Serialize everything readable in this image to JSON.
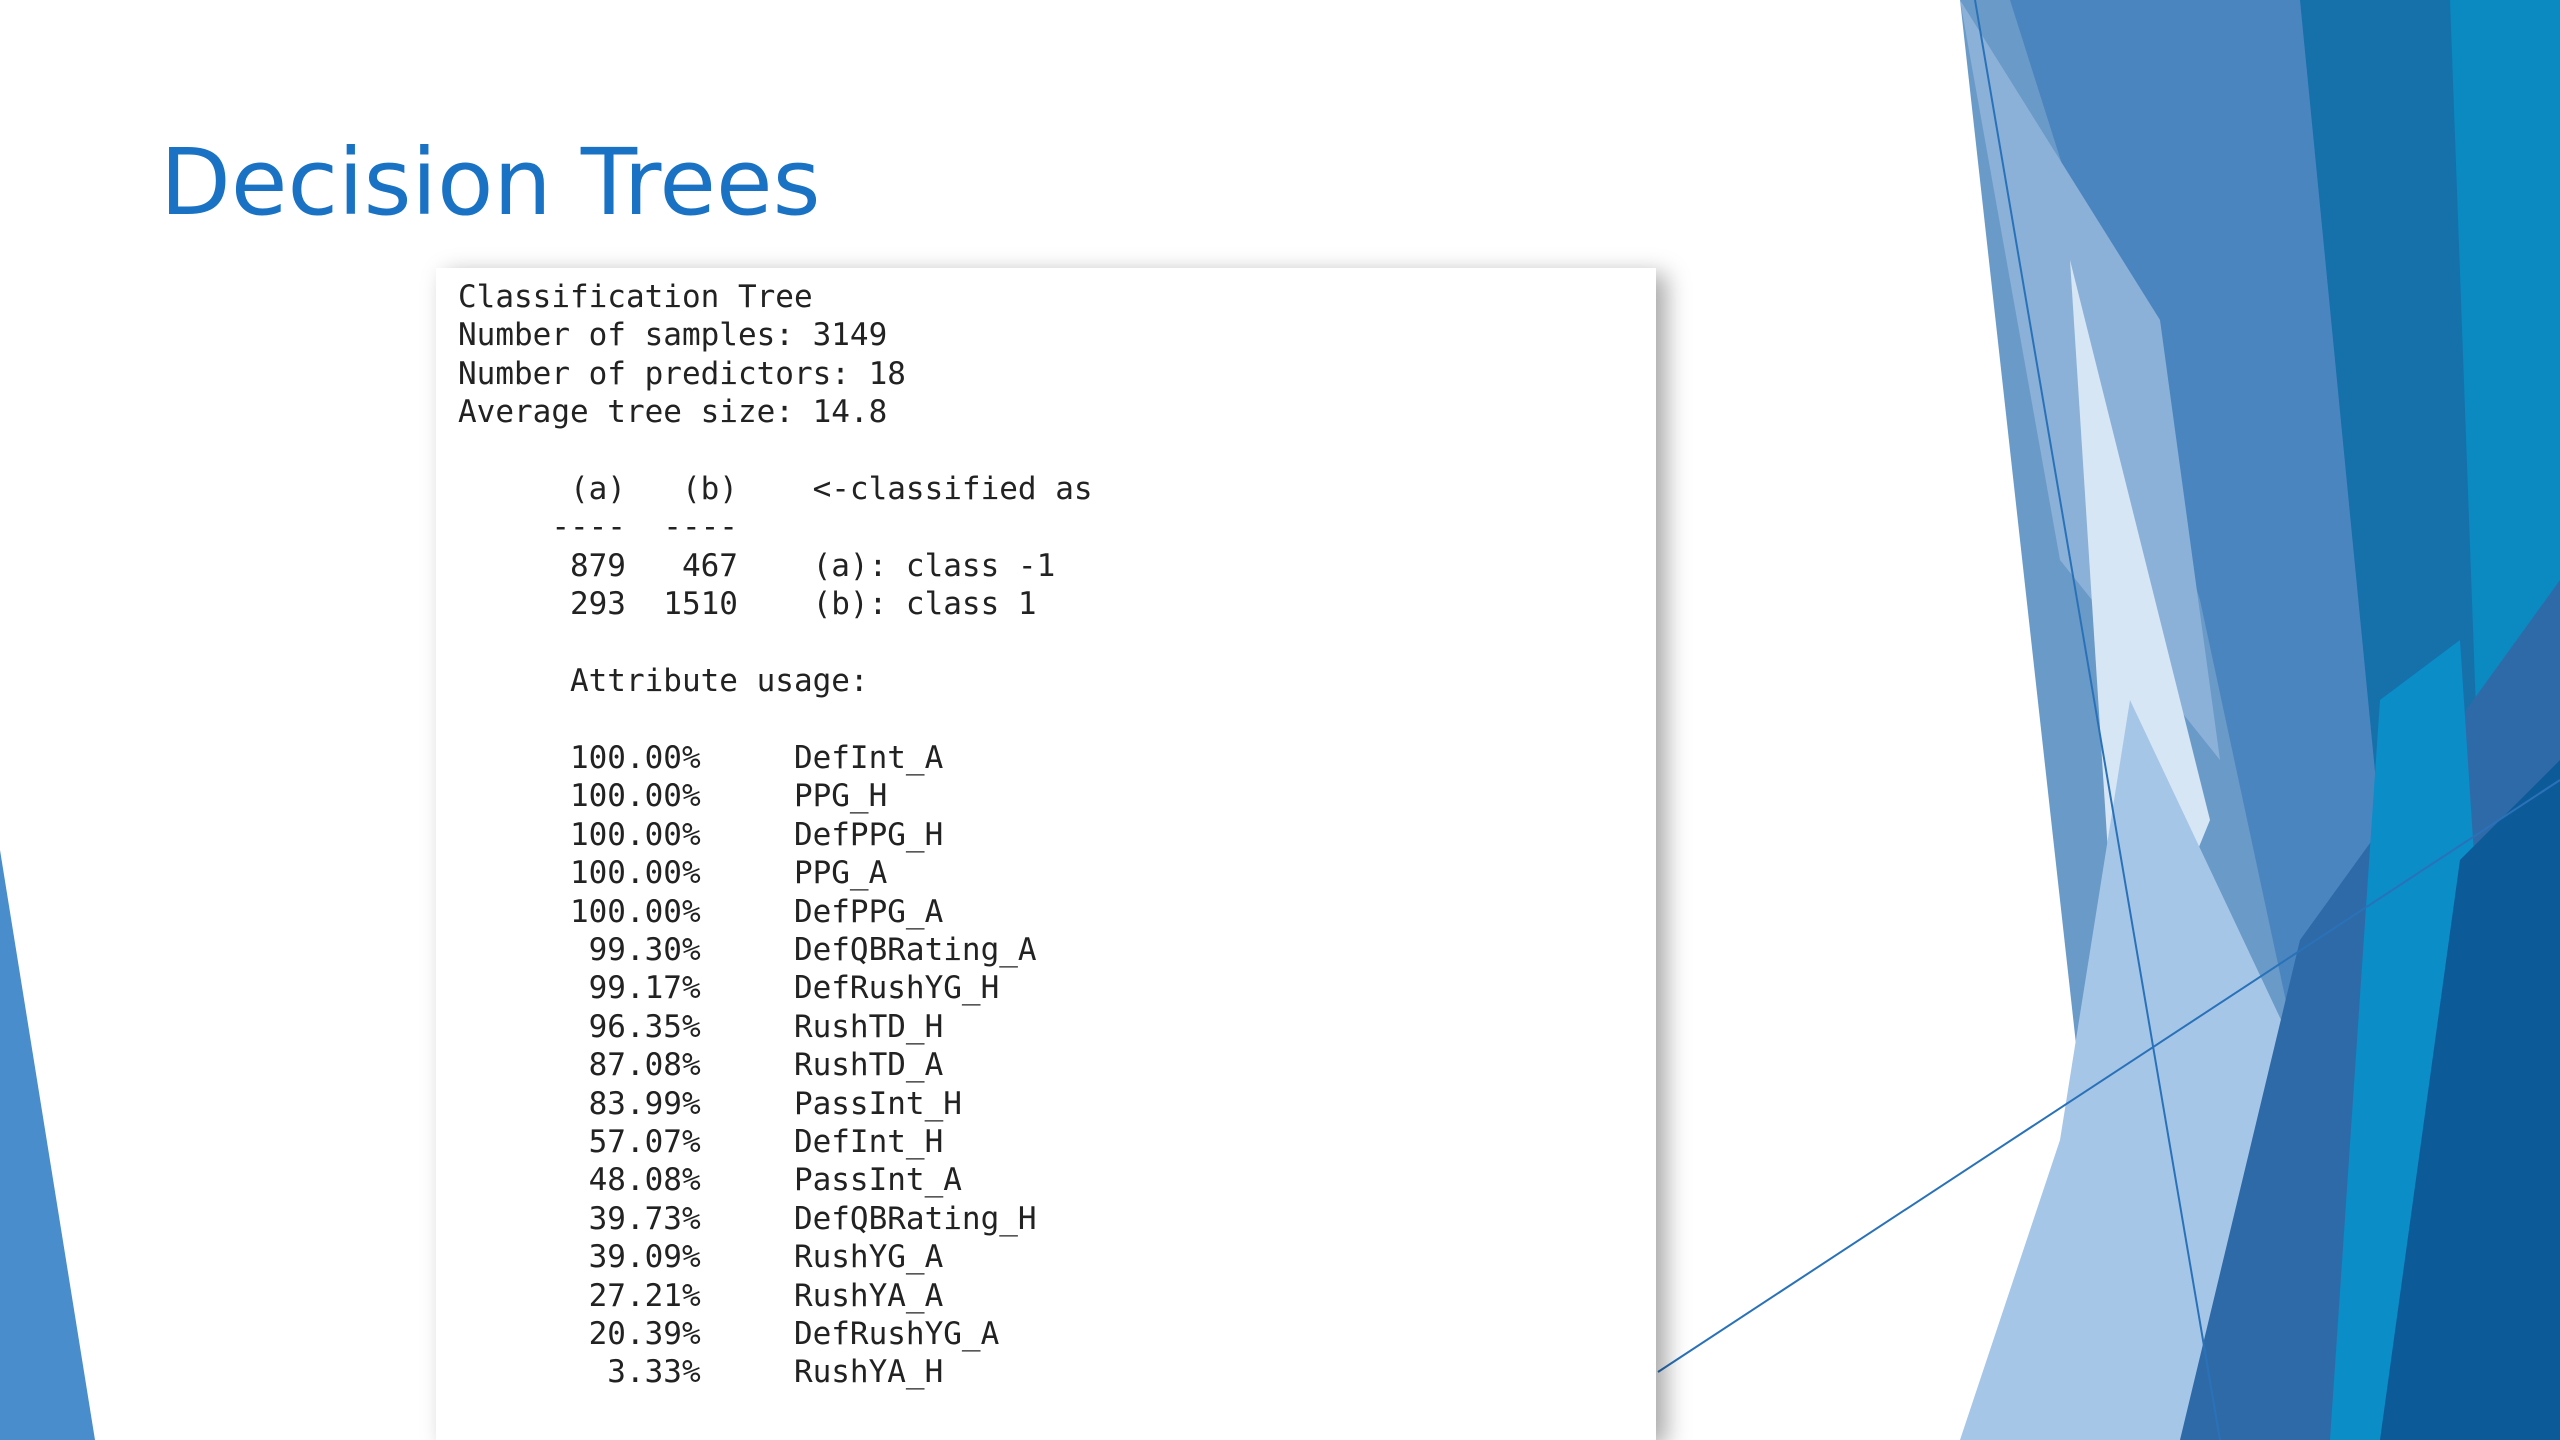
{
  "slide": {
    "title": "Decision Trees",
    "accent_color": "#1a72c4"
  },
  "output": {
    "lines": [
      "Classification Tree",
      "Number of samples: 3149",
      "Number of predictors: 18",
      "Average tree size: 14.8",
      "",
      "      (a)   (b)    <-classified as",
      "     ----  ----",
      "      879   467    (a): class -1",
      "      293  1510    (b): class 1",
      "",
      "      Attribute usage:",
      "",
      "      100.00%     DefInt_A",
      "      100.00%     PPG_H",
      "      100.00%     DefPPG_H",
      "      100.00%     PPG_A",
      "      100.00%     DefPPG_A",
      "       99.30%     DefQBRating_A",
      "       99.17%     DefRushYG_H",
      "       96.35%     RushTD_H",
      "       87.08%     RushTD_A",
      "       83.99%     PassInt_H",
      "       57.07%     DefInt_H",
      "       48.08%     PassInt_A",
      "       39.73%     DefQBRating_H",
      "       39.09%     RushYG_A",
      "       27.21%     RushYA_A",
      "       20.39%     DefRushYG_A",
      "        3.33%     RushYA_H"
    ]
  }
}
